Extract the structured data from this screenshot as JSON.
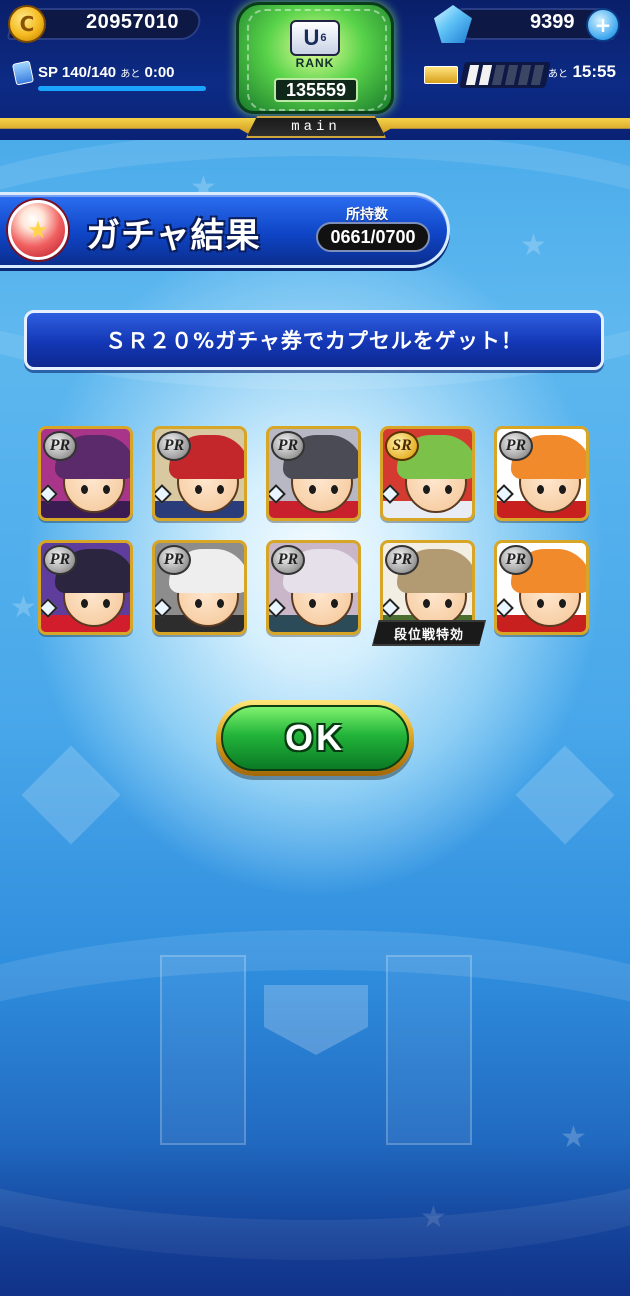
{
  "hud": {
    "coins": "20957010",
    "coin_symbol": "C",
    "sp_label": "SP",
    "sp_value": "140/140",
    "sp_remaining_prefix": "あと",
    "sp_remaining_time": "0:00",
    "gems": "9399",
    "gem_plus": "+",
    "stamina_remaining_prefix": "あと",
    "stamina_remaining_time": "15:55",
    "stamina_segments_filled": 2,
    "stamina_segments_total": 6,
    "rank_badge": "U",
    "rank_badge_sup": "6",
    "rank_label": "RANK",
    "rank_value": "135559",
    "profile_tag": "main"
  },
  "title_banner": {
    "title": "ガチャ結果",
    "owned_label": "所持数",
    "owned_value": "0661/0700"
  },
  "message": "ＳＲ２０%ガチャ券でカプセルをゲット！",
  "cards": [
    {
      "rarity": "PR",
      "hair_color": "#5b2a6a",
      "bg": "#a9358a",
      "bottom": "#3a1b52"
    },
    {
      "rarity": "PR",
      "hair_color": "#c3262b",
      "bg": "#d9c9a0",
      "bottom": "#2a3d7a"
    },
    {
      "rarity": "PR",
      "hair_color": "#4b4b56",
      "bg": "#b8b8c4",
      "bottom": "#c8202c"
    },
    {
      "rarity": "SR",
      "hair_color": "#7cc24a",
      "bg": "#d43a2f",
      "bottom": "#e8ecf4"
    },
    {
      "rarity": "PR",
      "hair_color": "#f08a2a",
      "bg": "#ffffff",
      "bottom": "#c81f1f"
    },
    {
      "rarity": "PR",
      "hair_color": "#2b2540",
      "bg": "#5e3d9c",
      "bottom": "#d21d2d"
    },
    {
      "rarity": "PR",
      "hair_color": "#eeeeee",
      "bg": "#8d8d8d",
      "bottom": "#2d2d2d"
    },
    {
      "rarity": "PR",
      "hair_color": "#e6e0ea",
      "bg": "#c9b6c9",
      "bottom": "#2c4b58"
    },
    {
      "rarity": "PR",
      "hair_color": "#b29a72",
      "bg": "#f3eee4",
      "bottom": "#4b6f2f"
    },
    {
      "rarity": "PR",
      "hair_color": "#f08a2a",
      "bg": "#ffffff",
      "bottom": "#c81f1f"
    }
  ],
  "card_tag": "段位戦特効",
  "ok_button": "OK"
}
